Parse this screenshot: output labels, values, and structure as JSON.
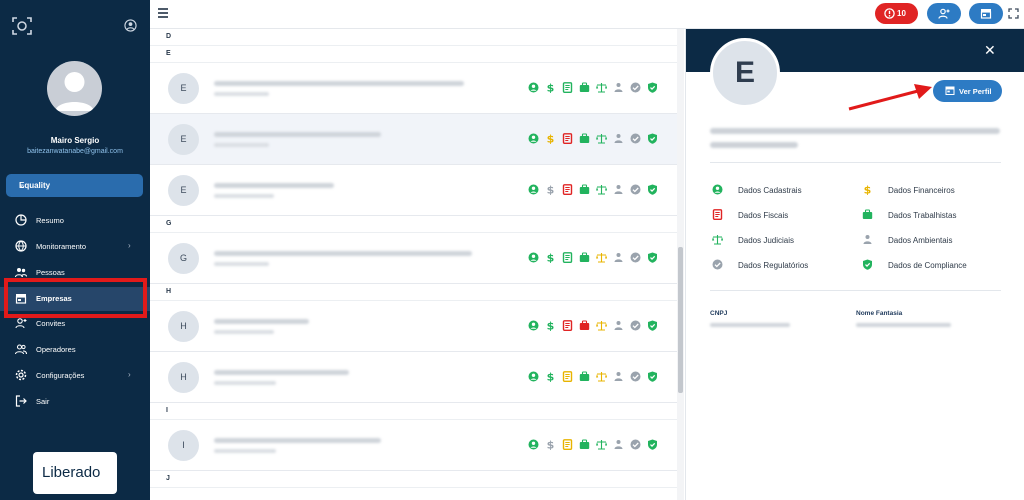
{
  "sidebar": {
    "user_name": "Mairo Sergio",
    "user_email": "baitezanwatanabe@gmail.com",
    "company_select": "Equality",
    "nav": [
      {
        "label": "Resumo",
        "icon": "pie-chart-icon",
        "has_arrow": false
      },
      {
        "label": "Monitoramento",
        "icon": "globe-icon",
        "has_arrow": true
      },
      {
        "label": "Pessoas",
        "icon": "people-icon",
        "has_arrow": false
      },
      {
        "label": "Empresas",
        "icon": "store-icon",
        "has_arrow": false,
        "active": true
      },
      {
        "label": "Convites",
        "icon": "user-plus-icon",
        "has_arrow": false
      },
      {
        "label": "Operadores",
        "icon": "users-icon",
        "has_arrow": false
      },
      {
        "label": "Configurações",
        "icon": "gear-icon",
        "has_arrow": true
      },
      {
        "label": "Sair",
        "icon": "logout-icon",
        "has_arrow": false
      }
    ],
    "brand": "Liberado"
  },
  "topbar": {
    "alert_count": "10",
    "colors": {
      "alert": "#e02424",
      "primary": "#2d7bc4"
    }
  },
  "list": {
    "sections": [
      {
        "letter": "D",
        "rows": []
      },
      {
        "letter": "E",
        "rows": [
          {
            "initial": "E",
            "icons": [
              "green",
              "green",
              "green",
              "green",
              "green",
              "gray",
              "gray",
              "green"
            ]
          },
          {
            "initial": "E",
            "selected": true,
            "icons": [
              "green",
              "yellow",
              "red",
              "green",
              "green",
              "gray",
              "gray",
              "green"
            ]
          },
          {
            "initial": "E",
            "icons": [
              "green",
              "gray",
              "red",
              "green",
              "green",
              "gray",
              "gray",
              "green"
            ]
          }
        ]
      },
      {
        "letter": "G",
        "rows": [
          {
            "initial": "G",
            "icons": [
              "green",
              "green",
              "green",
              "green",
              "yellow",
              "gray",
              "gray",
              "green"
            ]
          }
        ]
      },
      {
        "letter": "H",
        "rows": [
          {
            "initial": "H",
            "icons": [
              "green",
              "green",
              "red",
              "red",
              "yellow",
              "gray",
              "gray",
              "green"
            ]
          },
          {
            "initial": "H",
            "icons": [
              "green",
              "green",
              "yellow",
              "green",
              "yellow",
              "gray",
              "gray",
              "green"
            ]
          }
        ]
      },
      {
        "letter": "I",
        "rows": [
          {
            "initial": "I",
            "icons": [
              "green",
              "gray",
              "yellow",
              "green",
              "green",
              "gray",
              "gray",
              "green"
            ]
          }
        ]
      },
      {
        "letter": "J",
        "rows": []
      }
    ]
  },
  "panel": {
    "initial": "E",
    "ver_perfil": "Ver Perfil",
    "categories": [
      {
        "label": "Dados Cadastrais",
        "icon": "user-circle-icon",
        "color": "#22b35e"
      },
      {
        "label": "Dados Financeiros",
        "icon": "dollar-icon",
        "color": "#e8b400"
      },
      {
        "label": "Dados Fiscais",
        "icon": "receipt-icon",
        "color": "#e02424"
      },
      {
        "label": "Dados Trabalhistas",
        "icon": "briefcase-icon",
        "color": "#22b35e"
      },
      {
        "label": "Dados Judiciais",
        "icon": "scale-icon",
        "color": "#22b35e"
      },
      {
        "label": "Dados Ambientais",
        "icon": "leaf-person-icon",
        "color": "#9aa3ad"
      },
      {
        "label": "Dados Regulatórios",
        "icon": "check-badge-icon",
        "color": "#9aa3ad"
      },
      {
        "label": "Dados de Compliance",
        "icon": "shield-icon",
        "color": "#22b35e"
      }
    ],
    "cnpj_label": "CNPJ",
    "fantasia_label": "Nome Fantasia"
  }
}
